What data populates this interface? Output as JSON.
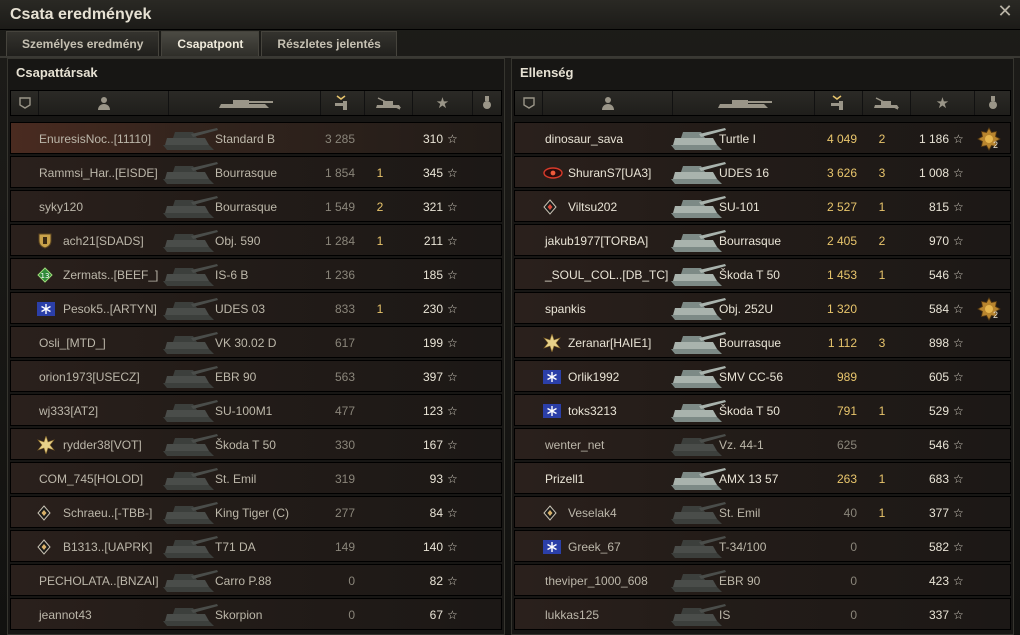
{
  "window": {
    "title": "Csata eredmények"
  },
  "tabs": [
    {
      "label": "Személyes eredmény",
      "active": false
    },
    {
      "label": "Csapatpont",
      "active": true
    },
    {
      "label": "Részletes jelentés",
      "active": false
    }
  ],
  "left": {
    "title": "Csapattársak",
    "rows": [
      {
        "player": "EnuresisNoc..[11110]",
        "tank": "Standard B",
        "damage": "3 285",
        "kills": "",
        "xp": "310",
        "icon": "",
        "alive": false,
        "highlight": true
      },
      {
        "player": "Rammsi_Har..[EISDE]",
        "tank": "Bourrasque",
        "damage": "1 854",
        "kills": "1",
        "xp": "345",
        "icon": "",
        "alive": false
      },
      {
        "player": "syky120",
        "tank": "Bourrasque",
        "damage": "1 549",
        "kills": "2",
        "xp": "321",
        "icon": "",
        "alive": false
      },
      {
        "player": "ach21[SDADS]",
        "tank": "Obj. 590",
        "damage": "1 284",
        "kills": "1",
        "xp": "211",
        "icon": "shield-badge",
        "alive": false
      },
      {
        "player": "Zermats..[BEEF_]",
        "tank": "IS-6 B",
        "damage": "1 236",
        "kills": "",
        "xp": "185",
        "icon": "green-13-badge",
        "alive": false
      },
      {
        "player": "Pesok5..[ARTYN]",
        "tank": "UDES 03",
        "damage": "833",
        "kills": "1",
        "xp": "230",
        "icon": "snowflake-badge",
        "alive": false
      },
      {
        "player": "Osli_[MTD_]",
        "tank": "VK 30.02 D",
        "damage": "617",
        "kills": "",
        "xp": "199",
        "icon": "",
        "alive": false
      },
      {
        "player": "orion1973[USECZ]",
        "tank": "EBR 90",
        "damage": "563",
        "kills": "",
        "xp": "397",
        "icon": "",
        "alive": false
      },
      {
        "player": "wj333[AT2]",
        "tank": "SU-100M1",
        "damage": "477",
        "kills": "",
        "xp": "123",
        "icon": "",
        "alive": false
      },
      {
        "player": "rydder38[VOT]",
        "tank": "Škoda T 50",
        "damage": "330",
        "kills": "",
        "xp": "167",
        "icon": "gold-star-badge",
        "alive": false
      },
      {
        "player": "COM_745[HOLOD]",
        "tank": "St. Emil",
        "damage": "319",
        "kills": "",
        "xp": "93",
        "icon": "",
        "alive": false
      },
      {
        "player": "Schraeu..[-TBB-]",
        "tank": "King Tiger (C)",
        "damage": "277",
        "kills": "",
        "xp": "84",
        "icon": "diamond-badge",
        "alive": false
      },
      {
        "player": "B1313..[UAPRK]",
        "tank": "T71 DA",
        "damage": "149",
        "kills": "",
        "xp": "140",
        "icon": "diamond-badge",
        "alive": false
      },
      {
        "player": "PECHOLATA..[BNZAI]",
        "tank": "Carro P.88",
        "damage": "0",
        "kills": "",
        "xp": "82",
        "icon": "",
        "alive": false
      },
      {
        "player": "jeannot43",
        "tank": "Skorpion",
        "damage": "0",
        "kills": "",
        "xp": "67",
        "icon": "",
        "alive": false
      }
    ]
  },
  "right": {
    "title": "Ellenség",
    "rows": [
      {
        "player": "dinosaur_sava",
        "tank": "Turtle I",
        "damage": "4 049",
        "kills": "2",
        "xp": "1 186",
        "icon": "",
        "alive": true,
        "medal": "2"
      },
      {
        "player": "ShuranS7[UA3]",
        "tank": "UDES 16",
        "damage": "3 626",
        "kills": "3",
        "xp": "1 008",
        "icon": "red-eye-badge",
        "alive": true
      },
      {
        "player": "Viltsu202",
        "tank": "SU-101",
        "damage": "2 527",
        "kills": "1",
        "xp": "815",
        "icon": "diamond-red-badge",
        "alive": true
      },
      {
        "player": "jakub1977[TORBA]",
        "tank": "Bourrasque",
        "damage": "2 405",
        "kills": "2",
        "xp": "970",
        "icon": "",
        "alive": true
      },
      {
        "player": "_SOUL_COL..[DB_TC]",
        "tank": "Škoda T 50",
        "damage": "1 453",
        "kills": "1",
        "xp": "546",
        "icon": "",
        "alive": true
      },
      {
        "player": "spankis",
        "tank": "Obj. 252U",
        "damage": "1 320",
        "kills": "",
        "xp": "584",
        "icon": "",
        "alive": true,
        "medal": "2"
      },
      {
        "player": "Zeranar[HAIE1]",
        "tank": "Bourrasque",
        "damage": "1 112",
        "kills": "3",
        "xp": "898",
        "icon": "gold-star-badge",
        "alive": true
      },
      {
        "player": "Orlik1992",
        "tank": "SMV CC-56",
        "damage": "989",
        "kills": "",
        "xp": "605",
        "icon": "snowflake-badge",
        "alive": true
      },
      {
        "player": "toks3213",
        "tank": "Škoda T 50",
        "damage": "791",
        "kills": "1",
        "xp": "529",
        "icon": "snowflake-badge",
        "alive": true
      },
      {
        "player": "wenter_net",
        "tank": "Vz. 44-1",
        "damage": "625",
        "kills": "",
        "xp": "546",
        "icon": "",
        "alive": false
      },
      {
        "player": "Prizell1",
        "tank": "AMX 13 57",
        "damage": "263",
        "kills": "1",
        "xp": "683",
        "icon": "",
        "alive": true
      },
      {
        "player": "Veselak4",
        "tank": "St. Emil",
        "damage": "40",
        "kills": "1",
        "xp": "377",
        "icon": "diamond-badge",
        "alive": false
      },
      {
        "player": "Greek_67",
        "tank": "T-34/100",
        "damage": "0",
        "kills": "",
        "xp": "582",
        "icon": "snowflake-badge",
        "alive": false
      },
      {
        "player": "theviper_1000_608",
        "tank": "EBR 90",
        "damage": "0",
        "kills": "",
        "xp": "423",
        "icon": "",
        "alive": false
      },
      {
        "player": "lukkas125",
        "tank": "IS",
        "damage": "0",
        "kills": "",
        "xp": "337",
        "icon": "",
        "alive": false
      }
    ]
  },
  "colors": {
    "gold": "#e8c56c",
    "alive_text": "#e9e4d6",
    "dead_text": "#bcb7aa"
  }
}
